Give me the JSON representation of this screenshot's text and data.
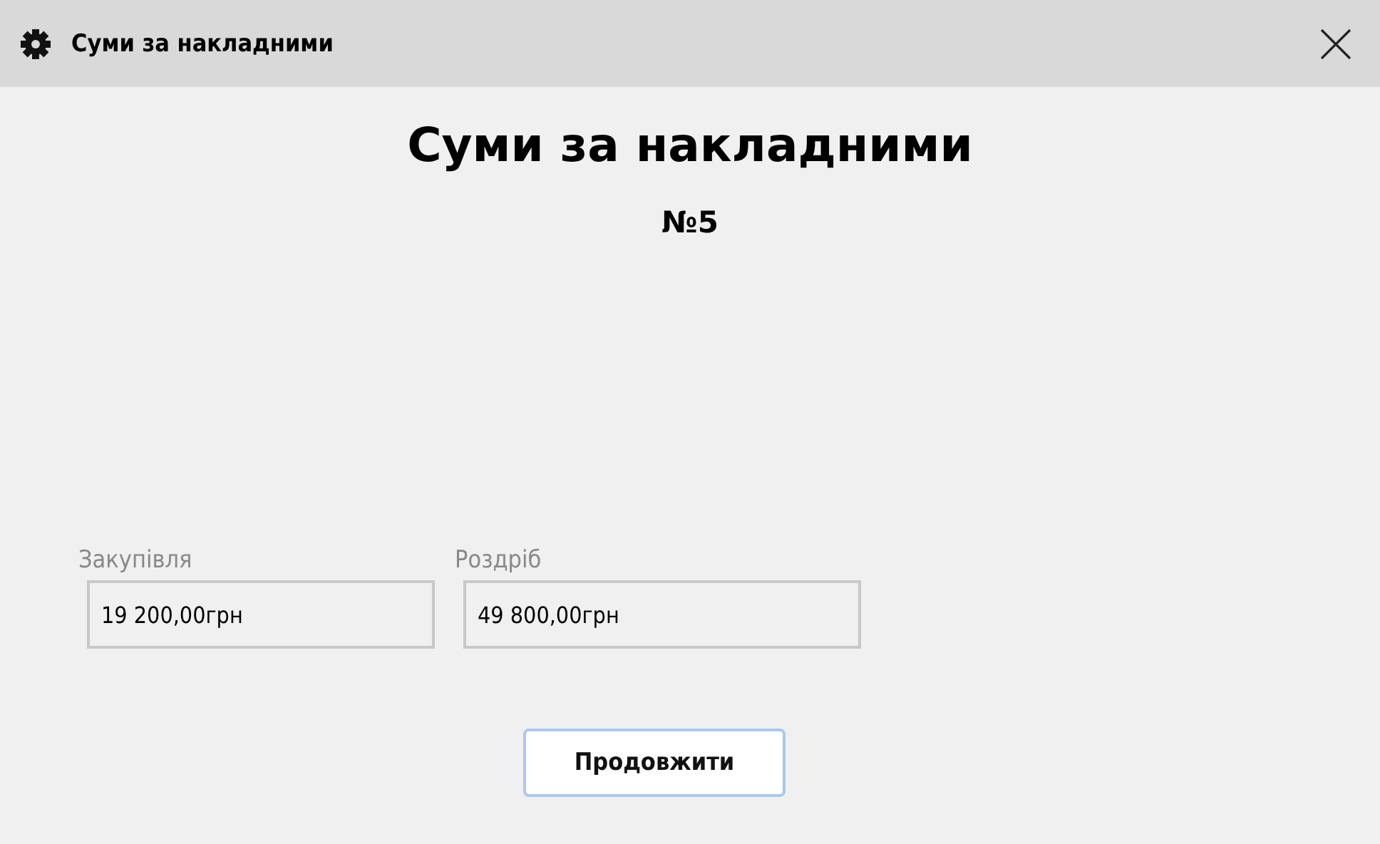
{
  "window": {
    "title": "Суми за накладними"
  },
  "heading": "Суми за накладними",
  "number": "№5",
  "fields": [
    {
      "label": "Закупівля",
      "value": "19 200,00грн"
    },
    {
      "label": "Роздріб",
      "value": "49 800,00грн"
    }
  ],
  "buttons": [
    {
      "label": "Продовжити",
      "focused": true
    }
  ]
}
